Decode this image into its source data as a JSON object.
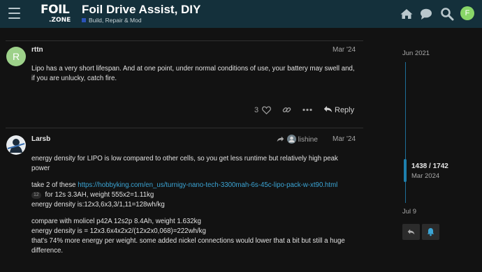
{
  "header": {
    "logo_main": "FOIL",
    "logo_sub": ".ZONE",
    "title": "Foil Drive Assist, DIY",
    "category": "Build, Repair & Mod",
    "user_initial": "F",
    "icons": [
      "hamburger-icon",
      "home-icon",
      "chat-icon",
      "search-icon"
    ]
  },
  "posts": [
    {
      "avatar_initial": "R",
      "avatar_color": "#9dd18a",
      "username": "rttn",
      "date": "Mar '24",
      "body": "Lipo has a very short lifespan. And at one point, under normal conditions of use, your battery may swell and, if you are unlucky, catch fire.",
      "like_count": "3",
      "reply_label": "Reply"
    },
    {
      "username": "Larsb",
      "reply_to": "lishine",
      "date": "Mar '24",
      "p1": "energy density for LIPO is low compared to other cells, so you get less runtime but relatively high peak power",
      "p2_prefix": "take 2 of these ",
      "p2_link": "https://hobbyking.com/en_us/turnigy-nano-tech-3300mah-6s-45c-lipo-pack-w-xt90.html",
      "p2_badge": "12",
      "p2_line2": " for 12s 3.3AH, weight 555x2=1.11kg",
      "p2_line3": "energy density is:12x3,6x3,3/1,11=128wh/kg",
      "p3_line1": "compare with molicel p42A 12s2p 8.4Ah, weight 1.632kg",
      "p3_line2": "energy density is = 12x3.6x4x2x2/(12x2x0,068)=222wh/kg",
      "p3_line3": "that's 74% more energy per weight. some added nickel connections would lower that a bit but still a huge difference."
    }
  ],
  "timeline": {
    "start": "Jun 2021",
    "position": "1438 / 1742",
    "position_date": "Mar 2024",
    "end": "Jul 9"
  },
  "colors": {
    "header_bg": "#14303b",
    "page_bg": "#121212",
    "link": "#3ba5d5",
    "timeline": "#1d6e98",
    "category": "#2b52b8"
  }
}
